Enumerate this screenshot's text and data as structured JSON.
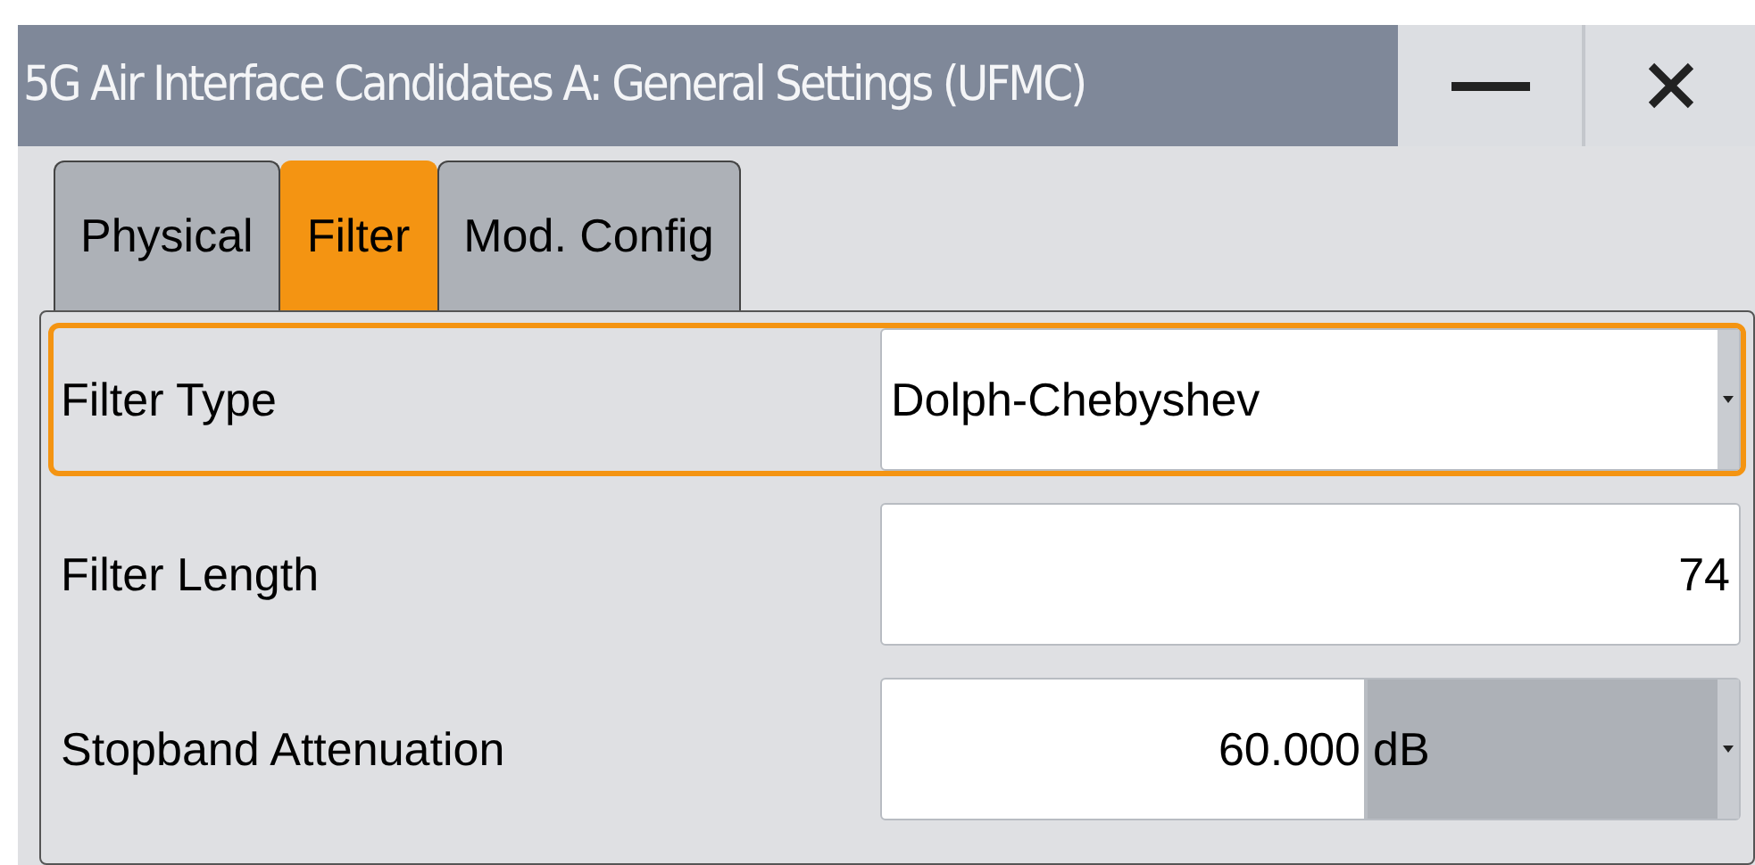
{
  "window": {
    "title": "5G Air Interface Candidates A: General Settings (UFMC)"
  },
  "tabs": [
    {
      "label": "Physical",
      "selected": false
    },
    {
      "label": "Filter",
      "selected": true
    },
    {
      "label": "Mod. Config",
      "selected": false
    }
  ],
  "rows": [
    {
      "kind": "dropdown",
      "label": "Filter Type",
      "value": "Dolph-Chebyshev",
      "focused": true
    },
    {
      "kind": "number",
      "label": "Filter Length",
      "value": "74",
      "focused": false
    },
    {
      "kind": "number_unit",
      "label": "Stopband Attenuation",
      "value": "60.000",
      "unit": "dB",
      "focused": false
    }
  ]
}
